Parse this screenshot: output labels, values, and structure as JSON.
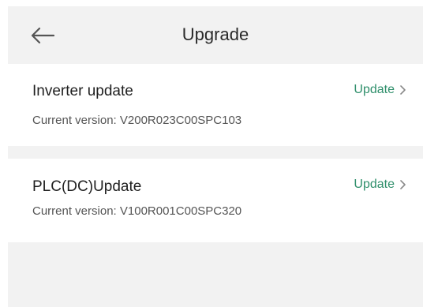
{
  "header": {
    "title": "Upgrade",
    "back_icon": "arrow-left-icon"
  },
  "items": [
    {
      "name": "Inverter update",
      "version": "Current version:  V200R023C00SPC103",
      "action": "Update",
      "action_icon": "chevron-right-icon"
    },
    {
      "name": "PLC(DC)Update",
      "version": "Current version:  V100R001C00SPC320",
      "action": "Update",
      "action_icon": "chevron-right-icon"
    }
  ],
  "colors": {
    "accent": "#2f8f6b",
    "background_gray": "#f2f2f2"
  }
}
